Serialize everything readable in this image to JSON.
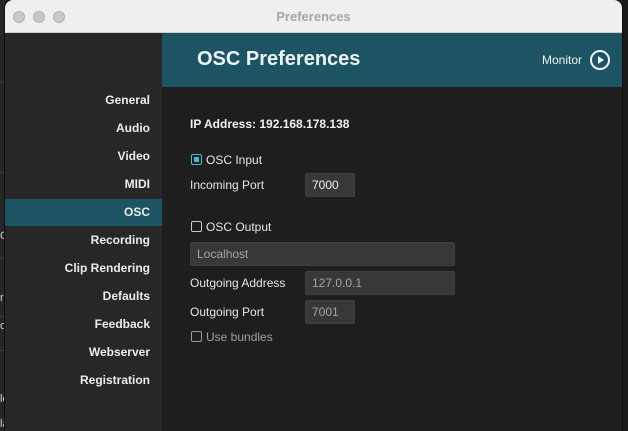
{
  "window": {
    "title": "Preferences"
  },
  "background_fragments": [
    "Gi",
    "re",
    "o",
    "lo",
    "la"
  ],
  "sidebar": {
    "items": [
      {
        "label": "General",
        "active": false
      },
      {
        "label": "Audio",
        "active": false
      },
      {
        "label": "Video",
        "active": false
      },
      {
        "label": "MIDI",
        "active": false
      },
      {
        "label": "OSC",
        "active": true
      },
      {
        "label": "Recording",
        "active": false
      },
      {
        "label": "Clip Rendering",
        "active": false
      },
      {
        "label": "Defaults",
        "active": false
      },
      {
        "label": "Feedback",
        "active": false
      },
      {
        "label": "Webserver",
        "active": false
      },
      {
        "label": "Registration",
        "active": false
      }
    ]
  },
  "header": {
    "title": "OSC Preferences",
    "monitor_label": "Monitor",
    "monitor_icon": "play-circle-icon"
  },
  "osc": {
    "ip_address": "IP Address: 192.168.178.138",
    "input": {
      "label": "OSC Input",
      "checked": true,
      "port_label": "Incoming Port",
      "port_value": "7000"
    },
    "output": {
      "label": "OSC Output",
      "checked": false,
      "target_value": "Localhost",
      "address_label": "Outgoing Address",
      "address_value": "127.0.0.1",
      "port_label": "Outgoing Port",
      "port_value": "7001"
    },
    "bundles": {
      "label": "Use bundles",
      "checked": false
    }
  },
  "colors": {
    "accent": "#1c5463",
    "checkbox_checked": "#4fb6d2"
  }
}
